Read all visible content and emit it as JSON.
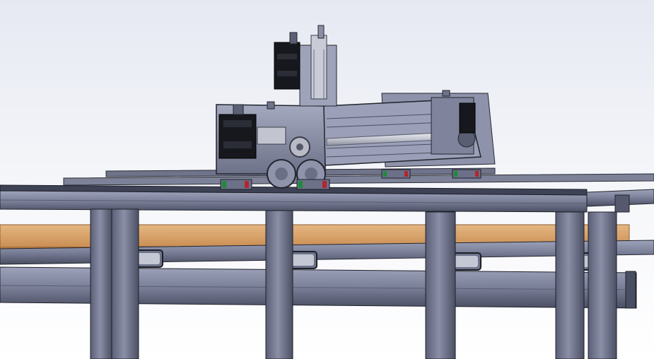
{
  "scene": {
    "subject": "cnc-gantry-router-cad-render",
    "colors": {
      "background_top": "#e9ecf4",
      "background_bottom": "#ffffff",
      "steel_light": "#8d92aa",
      "steel_mid": "#6e738c",
      "steel_dark": "#3f4357",
      "steel_edge": "#23252f",
      "wood_light": "#e2b27a",
      "wood_dark": "#c4894d",
      "motor_black": "#15161b",
      "bearing_green": "#1f8a3c",
      "bearing_red": "#b3262d",
      "rod_silver": "#d8dbe3"
    },
    "icons": [
      "stepper-motor-icon",
      "pulley-icon",
      "linear-rail-icon",
      "ball-screw-icon"
    ]
  }
}
